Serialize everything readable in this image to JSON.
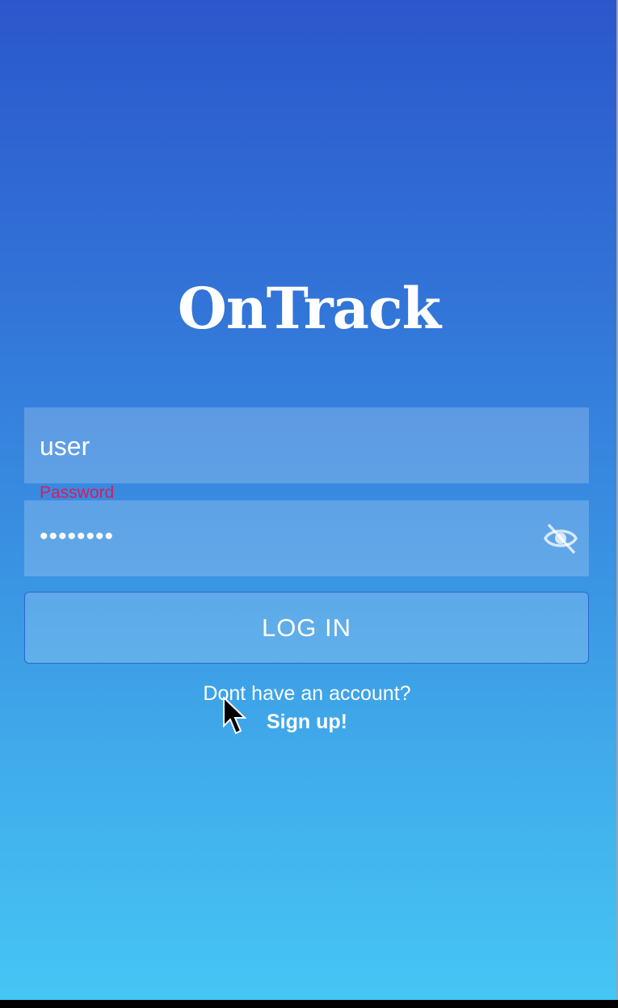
{
  "app": {
    "brand": "OnTrack"
  },
  "login_form": {
    "username_value": "user",
    "password_label": "Password",
    "password_value": "••••••••",
    "password_toggle_icon": "eye-off-icon",
    "login_label": "LOG IN"
  },
  "signup": {
    "prompt": "Dont have an account?",
    "link": "Sign up!"
  },
  "colors": {
    "gradient_top": "#2b57cc",
    "gradient_bottom": "#45c6f5",
    "label_accent": "#d81b60",
    "button_border": "#2f64d2",
    "text": "#ffffff"
  }
}
